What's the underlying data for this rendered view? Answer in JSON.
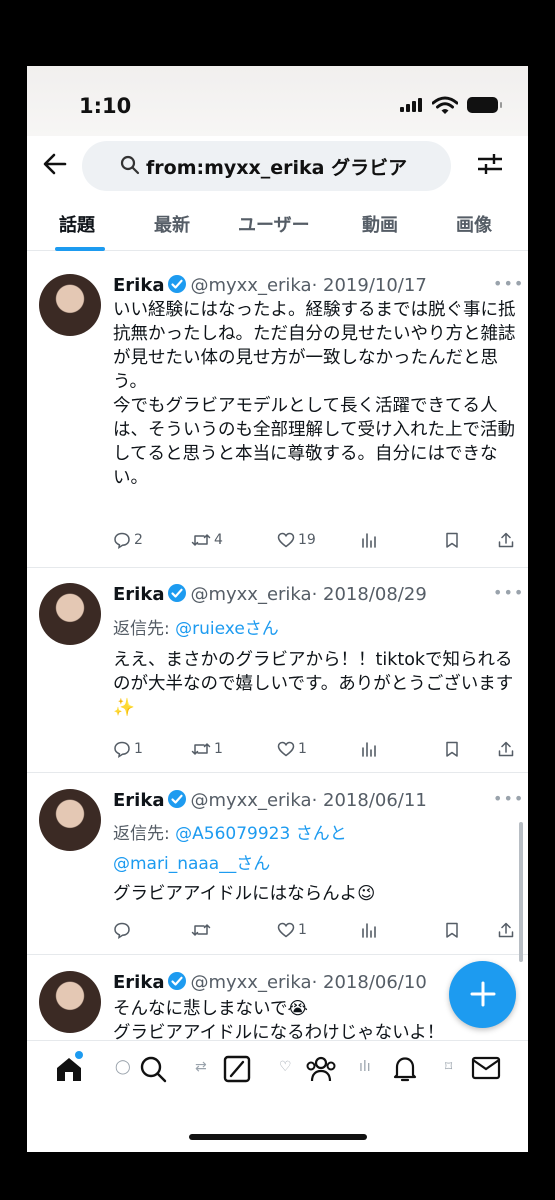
{
  "status": {
    "time": "1:10"
  },
  "search": {
    "query": "from:myxx_erika グラビア"
  },
  "tabs": [
    "話題",
    "最新",
    "ユーザー",
    "動画",
    "画像"
  ],
  "tweets": [
    {
      "name": "Erika",
      "handle": "@myxx_erika",
      "date": "· 2019/10/17",
      "text": "いい経験にはなったよ。経験するまでは脱ぐ事に抵抗無かったしね。ただ自分の見せたいやり方と雑誌が見せたい体の見せ方が一致しなかったんだと思う。\n今でもグラビアモデルとして長く活躍できてる人は、そういうのも全部理解して受け入れた上で活動してると思うと本当に尊敬する。自分にはできない。",
      "replies": "2",
      "retweets": "4",
      "likes": "19"
    },
    {
      "name": "Erika",
      "handle": "@myxx_erika",
      "date": "· 2018/08/29",
      "reply_prefix": "返信先:",
      "reply_to": "@ruiexeさん",
      "text": "ええ、まさかのグラビアから！！tiktokで知られるのが大半なので嬉しいです。ありがとうございます✨",
      "replies": "1",
      "retweets": "1",
      "likes": "1"
    },
    {
      "name": "Erika",
      "handle": "@myxx_erika",
      "date": "· 2018/06/11",
      "reply_prefix": "返信先:",
      "reply_to": "@A56079923 さんと",
      "reply_to2": "@mari_naaa__さん",
      "text": "グラビアアイドルにはならんよ😉",
      "replies": "",
      "retweets": "",
      "likes": "1"
    },
    {
      "name": "Erika",
      "handle": "@myxx_erika",
      "date": "· 2018/06/10",
      "text": "そんなに悲しまないで😭\nグラビアアイドルになるわけじゃないよ！"
    }
  ],
  "colors": {
    "accent": "#1d9bf0",
    "text": "#0f1419",
    "muted": "#555d66"
  }
}
